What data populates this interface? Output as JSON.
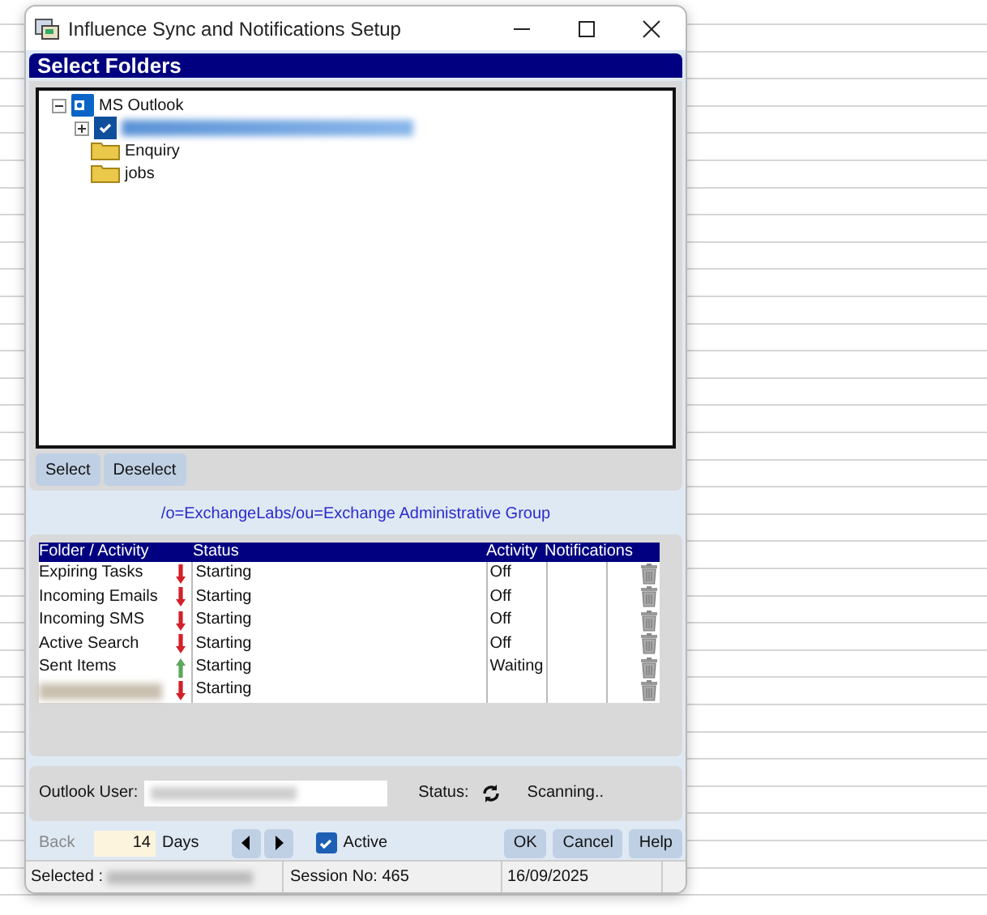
{
  "window": {
    "title": "Influence Sync and Notifications Setup"
  },
  "section_title": "Select Folders",
  "tree": {
    "label": "MS Outlook",
    "expanded": true,
    "children": [
      {
        "redacted": true,
        "checked": true,
        "expanded": false
      },
      {
        "label": "Enquiry"
      },
      {
        "label": "jobs"
      }
    ]
  },
  "folder_buttons": [
    "Select",
    "Deselect"
  ],
  "exchange_path": "/o=ExchangeLabs/ou=Exchange Administrative Group",
  "table": {
    "columns": [
      "Folder / Activity",
      "Status",
      "Activity",
      "Notifications"
    ],
    "rows": [
      {
        "name": "Expiring Tasks",
        "kind": "down",
        "status": "Starting",
        "activity": "Off"
      },
      {
        "name": "Incoming Emails",
        "kind": "down",
        "status": "Starting",
        "activity": "Off"
      },
      {
        "name": "Incoming SMS",
        "kind": "down",
        "status": "Starting",
        "activity": "Off"
      },
      {
        "name": "Active Search",
        "kind": "down",
        "status": "Starting",
        "activity": "Off"
      },
      {
        "name": "Sent Items",
        "kind": "up",
        "status": "Starting",
        "activity": "Waiting"
      },
      {
        "redacted": true,
        "kind": "down",
        "status": "Starting"
      }
    ]
  },
  "user": {
    "label": "Outlook User:",
    "status_label": "Status:",
    "status": "Scanning.."
  },
  "controls": {
    "back_label": "Back",
    "days_value": "14",
    "days_label": "Days",
    "active": {
      "label": "Active",
      "checked": true
    },
    "buttons": [
      "OK",
      "Cancel",
      "Help"
    ]
  },
  "status_bar": {
    "selected_label": "Selected :",
    "session": "Session No: 465",
    "date": "16/09/2025"
  }
}
